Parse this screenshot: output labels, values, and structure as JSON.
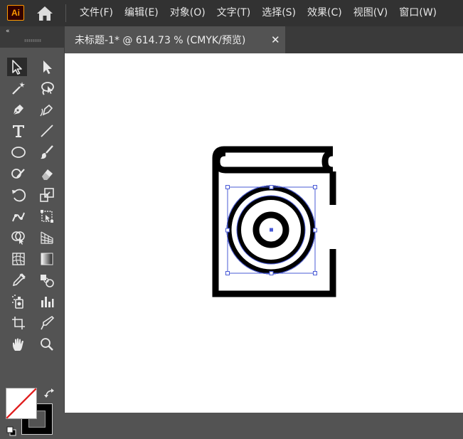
{
  "app": {
    "logo_text": "Ai"
  },
  "menu": {
    "items": [
      {
        "label": "文件(F)"
      },
      {
        "label": "编辑(E)"
      },
      {
        "label": "对象(O)"
      },
      {
        "label": "文字(T)"
      },
      {
        "label": "选择(S)"
      },
      {
        "label": "效果(C)"
      },
      {
        "label": "视图(V)"
      },
      {
        "label": "窗口(W)"
      }
    ]
  },
  "document": {
    "tab_title": "未标题-1* @ 614.73 % (CMYK/预览)",
    "close_glyph": "✕"
  },
  "toolbar": {
    "collapse_glyph": "«",
    "tools": [
      {
        "icon": "selection-arrow-icon",
        "active": true
      },
      {
        "icon": "direct-selection-icon"
      },
      {
        "icon": "magic-wand-icon"
      },
      {
        "icon": "lasso-icon"
      },
      {
        "icon": "pen-icon"
      },
      {
        "icon": "curvature-pen-icon"
      },
      {
        "icon": "type-icon"
      },
      {
        "icon": "line-segment-icon"
      },
      {
        "icon": "ellipse-icon"
      },
      {
        "icon": "paintbrush-icon"
      },
      {
        "icon": "shaper-icon"
      },
      {
        "icon": "eraser-icon"
      },
      {
        "icon": "rotate-icon"
      },
      {
        "icon": "scale-icon"
      },
      {
        "icon": "puppet-warp-icon"
      },
      {
        "icon": "free-transform-icon"
      },
      {
        "icon": "shape-builder-icon"
      },
      {
        "icon": "perspective-grid-icon"
      },
      {
        "icon": "mesh-icon"
      },
      {
        "icon": "gradient-icon"
      },
      {
        "icon": "eyedropper-icon"
      },
      {
        "icon": "blend-icon"
      },
      {
        "icon": "symbol-sprayer-icon"
      },
      {
        "icon": "column-graph-icon"
      },
      {
        "icon": "artboard-icon"
      },
      {
        "icon": "slice-icon"
      },
      {
        "icon": "hand-icon"
      },
      {
        "icon": "zoom-icon"
      }
    ]
  },
  "colors": {
    "fill": "#ffffff",
    "stroke": "#000000",
    "none_slash": "#e01e1e",
    "selection": "#4a5bd6",
    "menubar_bg": "#323232",
    "panel_bg": "#535353"
  }
}
